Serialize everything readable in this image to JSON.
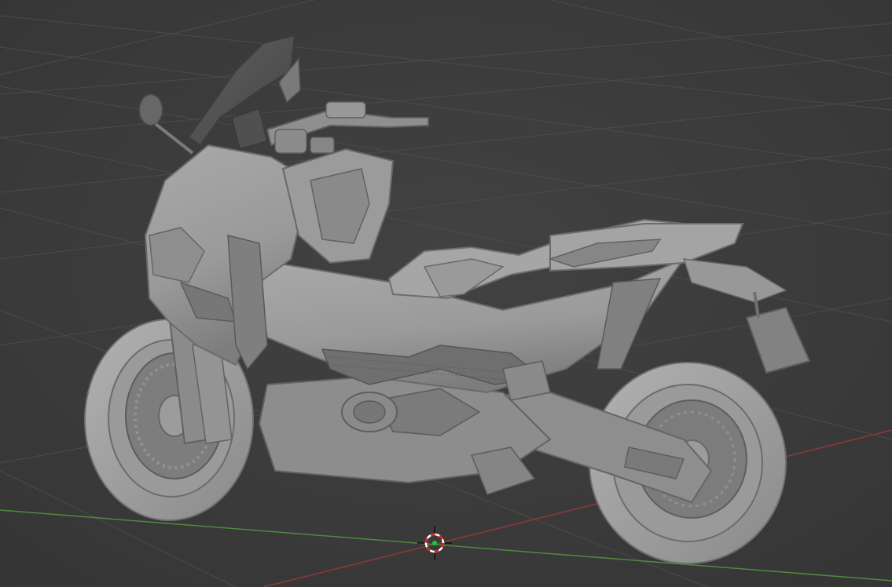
{
  "viewport": {
    "background": "#3d3d3d",
    "grid_color": "#4a4a4a",
    "x_axis_color": "#9a3a3a",
    "y_axis_color": "#4a8a3a",
    "object_name": "motorcycle-mesh",
    "shading": "solid",
    "mesh_color": "#9c9c9c"
  },
  "cursor_3d": {
    "icon": "3d-cursor-icon",
    "ring_color_a": "#e02020",
    "ring_color_b": "#ffffff",
    "center_color": "#21c435"
  }
}
